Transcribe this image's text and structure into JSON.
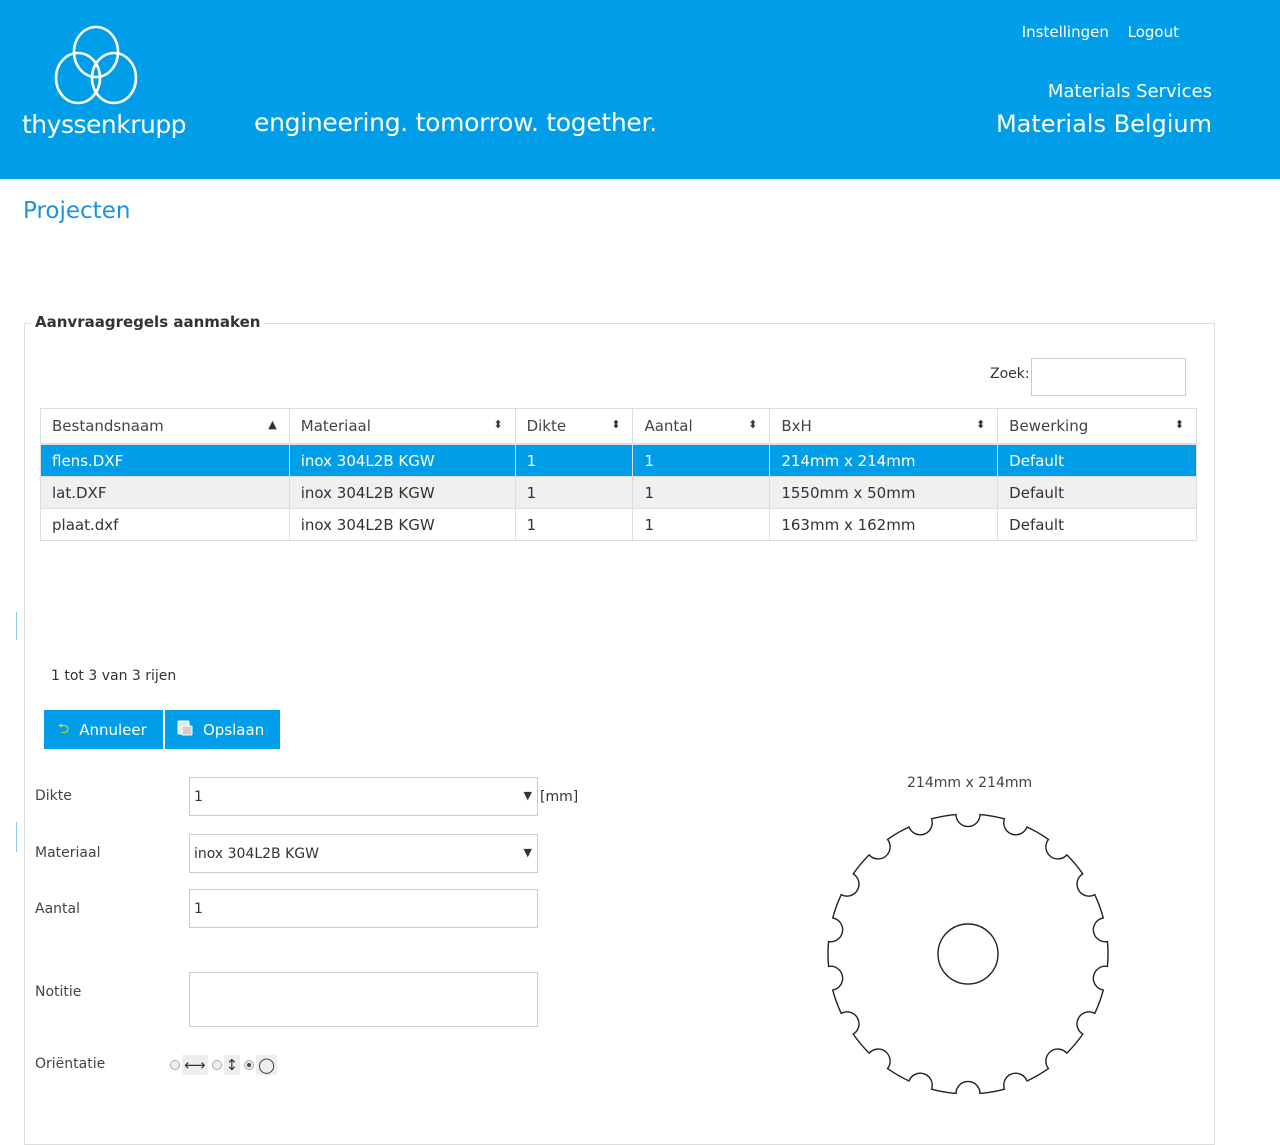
{
  "header": {
    "logo": "thyssenkrupp",
    "tagline": "engineering. tomorrow. together.",
    "links": {
      "settings": "Instellingen",
      "logout": "Logout"
    },
    "service_sub": "Materials Services",
    "service_main": "Materials Belgium",
    "brand_color": "#009ee8"
  },
  "page": {
    "title": "Projecten"
  },
  "panel": {
    "legend": "Aanvraagregels aanmaken"
  },
  "search": {
    "label": "Zoek:",
    "value": ""
  },
  "table": {
    "headers": [
      "Bestandsnaam",
      "Materiaal",
      "Dikte",
      "Aantal",
      "BxH",
      "Bewerking"
    ],
    "sorted_column": "Bestandsnaam",
    "rows": [
      {
        "file": "flens.DXF",
        "material": "inox 304L2B KGW",
        "thickness": "1",
        "qty": "1",
        "size": "214mm x 214mm",
        "op": "Default",
        "selected": true
      },
      {
        "file": "lat.DXF",
        "material": "inox 304L2B KGW",
        "thickness": "1",
        "qty": "1",
        "size": "1550mm x 50mm",
        "op": "Default"
      },
      {
        "file": "plaat.dxf",
        "material": "inox 304L2B KGW",
        "thickness": "1",
        "qty": "1",
        "size": "163mm x 162mm",
        "op": "Default"
      }
    ],
    "count": "1 tot 3 van 3 rijen"
  },
  "buttons": {
    "cancel": "Annuleer",
    "save": "Opslaan"
  },
  "form": {
    "thickness_label": "Dikte",
    "thickness_value": "1",
    "thickness_unit": "[mm]",
    "material_label": "Materiaal",
    "material_value": "inox 304L2B KGW",
    "qty_label": "Aantal",
    "qty_value": "1",
    "note_label": "Notitie",
    "note_value": "",
    "orientation_label": "Oriëntatie",
    "orientation_selected": "rotate",
    "orientation_icons": [
      "horizontal-arrow-icon",
      "vertical-arrow-icon",
      "circle-icon"
    ]
  },
  "preview": {
    "label": "214mm x 214mm"
  }
}
